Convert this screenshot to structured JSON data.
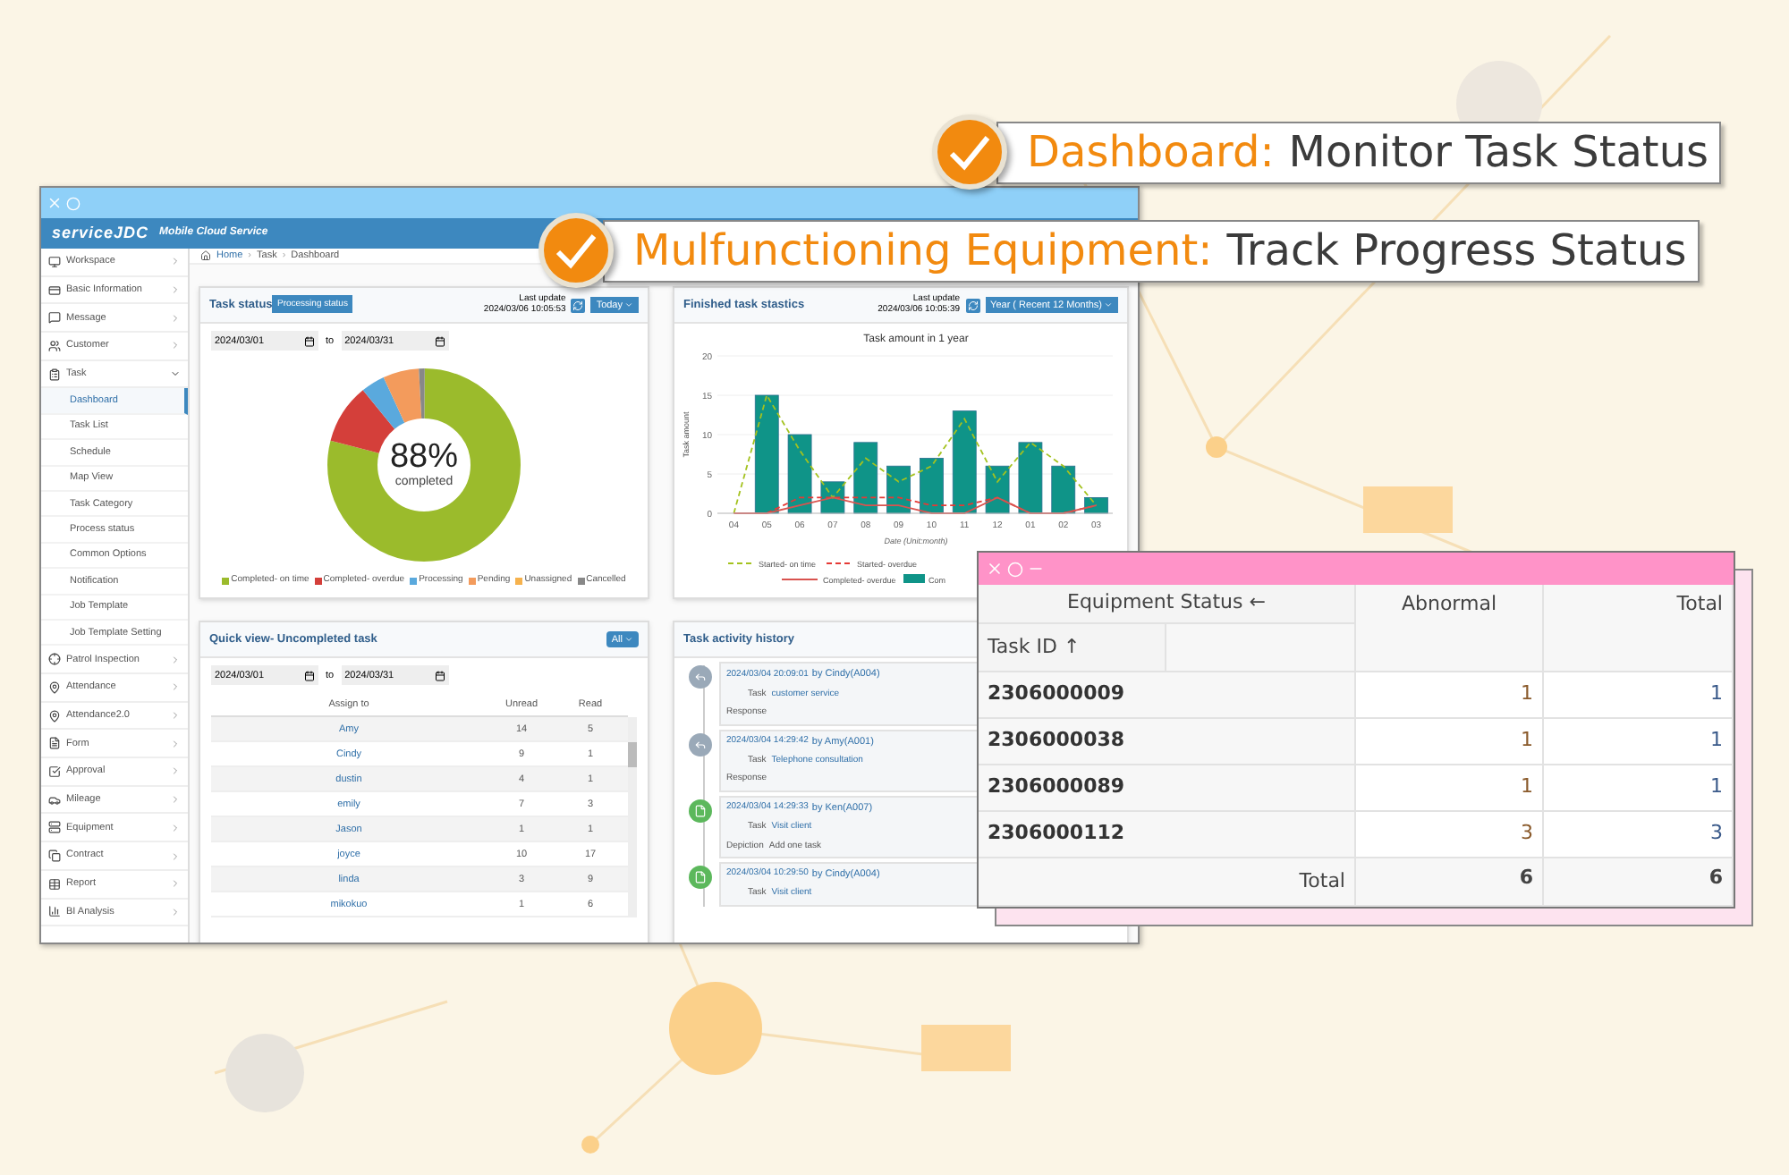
{
  "callouts": [
    {
      "highlight": "Dashboard:",
      "text": "Monitor Task Status"
    },
    {
      "highlight": "Mulfunctioning Equipment:",
      "text": "Track Progress Status"
    }
  ],
  "dashboard_window": {
    "app_logo": "serviceJDC",
    "app_subtitle": "Mobile Cloud Service",
    "breadcrumb": [
      "Home",
      "Task",
      "Dashboard"
    ],
    "breadcrumb_separator": "›",
    "sidebar": {
      "items": [
        {
          "label": "Workspace",
          "expanded": false
        },
        {
          "label": "Basic Information",
          "expanded": false
        },
        {
          "label": "Message",
          "expanded": false
        },
        {
          "label": "Customer",
          "expanded": false
        },
        {
          "label": "Task",
          "expanded": true,
          "children": [
            {
              "label": "Dashboard",
              "selected": true
            },
            {
              "label": "Task List",
              "selected": false
            },
            {
              "label": "Schedule",
              "selected": false
            },
            {
              "label": "Map View",
              "selected": false
            },
            {
              "label": "Task Category",
              "selected": false
            },
            {
              "label": "Process status",
              "selected": false
            },
            {
              "label": "Common Options",
              "selected": false
            },
            {
              "label": "Notification",
              "selected": false
            },
            {
              "label": "Job Template",
              "selected": false
            },
            {
              "label": "Job Template Setting",
              "selected": false
            }
          ]
        },
        {
          "label": "Patrol Inspection",
          "expanded": false
        },
        {
          "label": "Attendance",
          "expanded": false
        },
        {
          "label": "Attendance2.0",
          "expanded": false
        },
        {
          "label": "Form",
          "expanded": false
        },
        {
          "label": "Approval",
          "expanded": false
        },
        {
          "label": "Mileage",
          "expanded": false
        },
        {
          "label": "Equipment",
          "expanded": false
        },
        {
          "label": "Contract",
          "expanded": false
        },
        {
          "label": "Report",
          "expanded": false
        },
        {
          "label": "BI Analysis",
          "expanded": false
        }
      ]
    },
    "task_status": {
      "title": "Task status",
      "button": "Processing status",
      "last_update_label": "Last update",
      "last_update": "2024/03/06 10:05:53",
      "range": "Today",
      "date_from": "2024/03/01",
      "to": "to",
      "date_to": "2024/03/31",
      "percent": "88%",
      "percent_label": "completed",
      "legend": [
        {
          "label": "Completed- on time",
          "color": "#9bbb2c"
        },
        {
          "label": "Completed- overdue",
          "color": "#d43f3a"
        },
        {
          "label": "Processing",
          "color": "#5aa9dd"
        },
        {
          "label": "Pending",
          "color": "#f39b5c"
        },
        {
          "label": "Unassigned",
          "color": "#f6b24d"
        },
        {
          "label": "Cancelled",
          "color": "#888888"
        }
      ]
    },
    "finished_tasks": {
      "title": "Finished task stastics",
      "last_update_label": "Last update",
      "last_update": "2024/03/06 10:05:39",
      "range": "Year ( Recent 12 Months)",
      "chart_data": {
        "type": "bar",
        "title": "Task amount in 1 year",
        "xlabel": "Date (Unit:month)",
        "ylabel": "Task amount",
        "categories": [
          "04",
          "05",
          "06",
          "07",
          "08",
          "09",
          "10",
          "11",
          "12",
          "01",
          "02",
          "03"
        ],
        "ylim": [
          0,
          20
        ],
        "yticks": [
          0,
          5,
          10,
          15,
          20
        ],
        "grid": true,
        "legend": "bottom",
        "series": [
          {
            "name": "Com",
            "type": "bar",
            "color": "#0f9488",
            "values": [
              0,
              15,
              10,
              4,
              9,
              6,
              7,
              13,
              6,
              9,
              6,
              2
            ]
          },
          {
            "name": "Started- on time",
            "type": "line",
            "line_style": "dashed",
            "color": "#a4c21f",
            "values": [
              0,
              15,
              8,
              2,
              7,
              4,
              6,
              12,
              4,
              9,
              6,
              1
            ]
          },
          {
            "name": "Started- overdue",
            "type": "line",
            "line_style": "dashed",
            "color": "#e53935",
            "values": [
              null,
              0,
              2,
              2,
              2,
              2,
              1,
              1,
              2,
              0,
              0,
              1
            ]
          },
          {
            "name": "Completed- overdue",
            "type": "line",
            "line_style": "solid",
            "color": "#d9534f",
            "values": [
              0,
              0,
              1,
              2,
              1,
              1,
              0,
              0,
              2,
              0,
              0,
              1
            ]
          }
        ]
      }
    },
    "quick_view": {
      "title": "Quick view- Uncompleted task",
      "filter": "All",
      "date_from": "2024/03/01",
      "to": "to",
      "date_to": "2024/03/31",
      "columns": [
        "Assign to",
        "Unread",
        "Read"
      ],
      "rows": [
        [
          "Amy",
          "14",
          "5"
        ],
        [
          "Cindy",
          "9",
          "1"
        ],
        [
          "dustin",
          "4",
          "1"
        ],
        [
          "emily",
          "7",
          "3"
        ],
        [
          "Jason",
          "1",
          "1"
        ],
        [
          "joyce",
          "10",
          "17"
        ],
        [
          "linda",
          "3",
          "9"
        ],
        [
          "mikokuo",
          "1",
          "6"
        ]
      ]
    },
    "activity": {
      "title": "Task activity history",
      "entries": [
        {
          "kind": "response",
          "time": "2024/03/04 20:09:01",
          "by": "by Cindy(A004)",
          "task_label": "Task",
          "task": "customer service",
          "note_label": "Response"
        },
        {
          "kind": "response",
          "time": "2024/03/04 14:29:42",
          "by": "by Amy(A001)",
          "task_label": "Task",
          "task": "Telephone consultation",
          "note_label": "Response"
        },
        {
          "kind": "create",
          "time": "2024/03/04 14:29:33",
          "by": "by Ken(A007)",
          "task_label": "Task",
          "task": "Visit client",
          "note_label": "Depiction",
          "note": "Add one task"
        },
        {
          "kind": "create",
          "time": "2024/03/04 10:29:50",
          "by": "by Cindy(A004)",
          "task_label": "Task",
          "task": "Visit client"
        }
      ]
    }
  },
  "equipment_window": {
    "columns": [
      "Equipment Status ←",
      "Abnormal",
      "Total"
    ],
    "row_header": "Task ID ↑",
    "rows": [
      [
        "2306000009",
        "1",
        "1"
      ],
      [
        "2306000038",
        "1",
        "1"
      ],
      [
        "2306000089",
        "1",
        "1"
      ],
      [
        "2306000112",
        "3",
        "3"
      ]
    ],
    "total": [
      "Total",
      "6",
      "6"
    ]
  }
}
